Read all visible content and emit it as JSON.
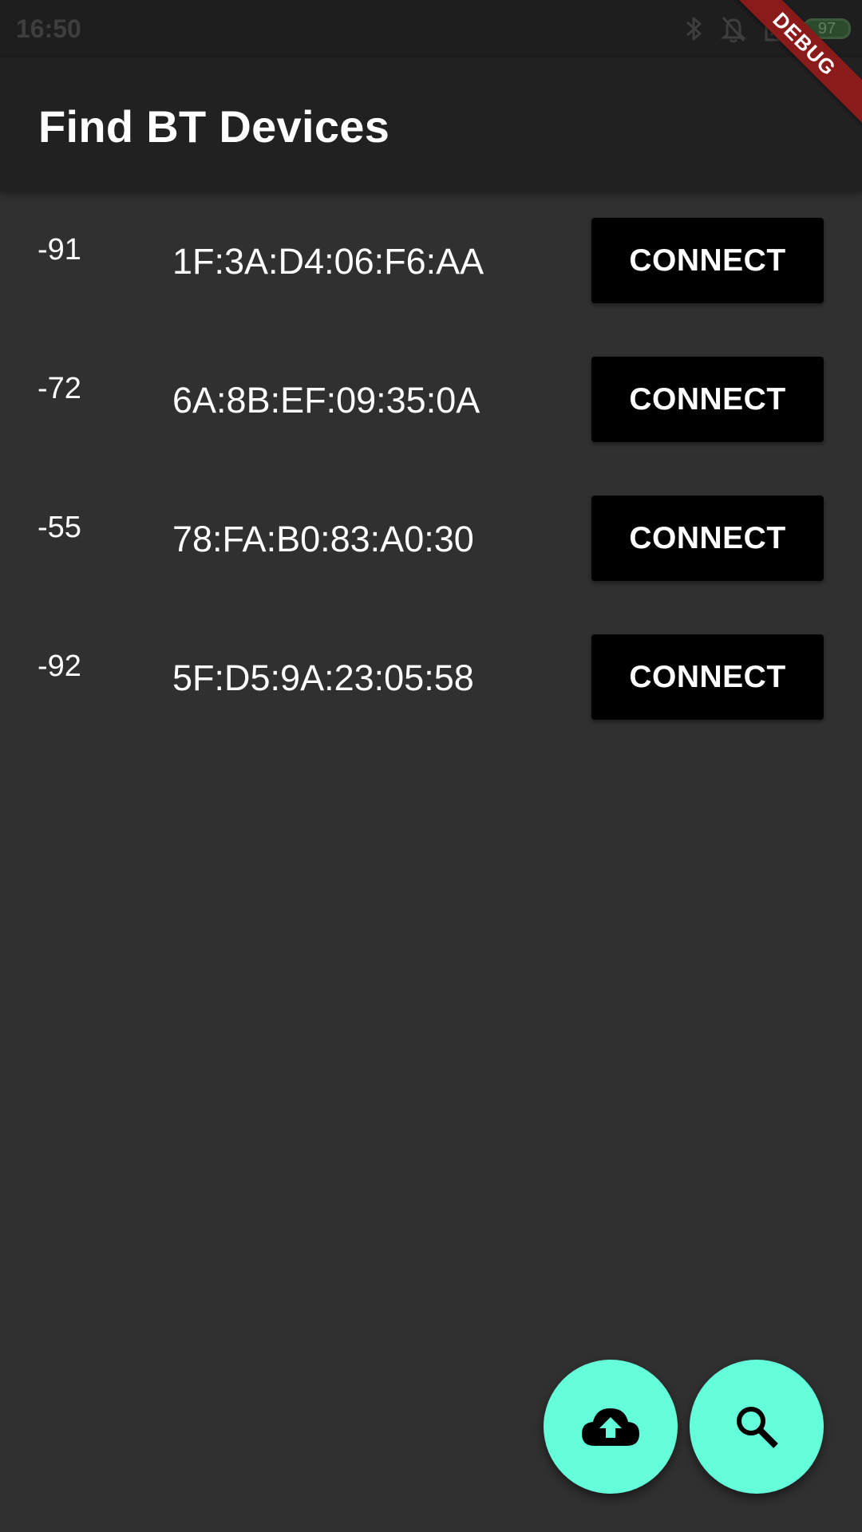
{
  "status_bar": {
    "time": "16:50",
    "battery": "97",
    "icons": [
      "bluetooth-icon",
      "notifications-off-icon",
      "sim-off-icon",
      "battery-icon"
    ]
  },
  "debug_banner": {
    "label": "DEBUG"
  },
  "app_bar": {
    "title": "Find BT Devices"
  },
  "devices": [
    {
      "rssi": "-91",
      "mac": "1F:3A:D4:06:F6:AA",
      "action_label": "CONNECT"
    },
    {
      "rssi": "-72",
      "mac": "6A:8B:EF:09:35:0A",
      "action_label": "CONNECT"
    },
    {
      "rssi": "-55",
      "mac": "78:FA:B0:83:A0:30",
      "action_label": "CONNECT"
    },
    {
      "rssi": "-92",
      "mac": "5F:D5:9A:23:05:58",
      "action_label": "CONNECT"
    }
  ],
  "fabs": [
    {
      "icon": "cloud-upload-icon"
    },
    {
      "icon": "search-icon"
    }
  ],
  "colors": {
    "background": "#303030",
    "app_bar": "#212121",
    "status_bar": "#1e1e1e",
    "fab_accent": "#64ffda",
    "button": "#000000",
    "debug_banner": "#8b1a1a"
  }
}
